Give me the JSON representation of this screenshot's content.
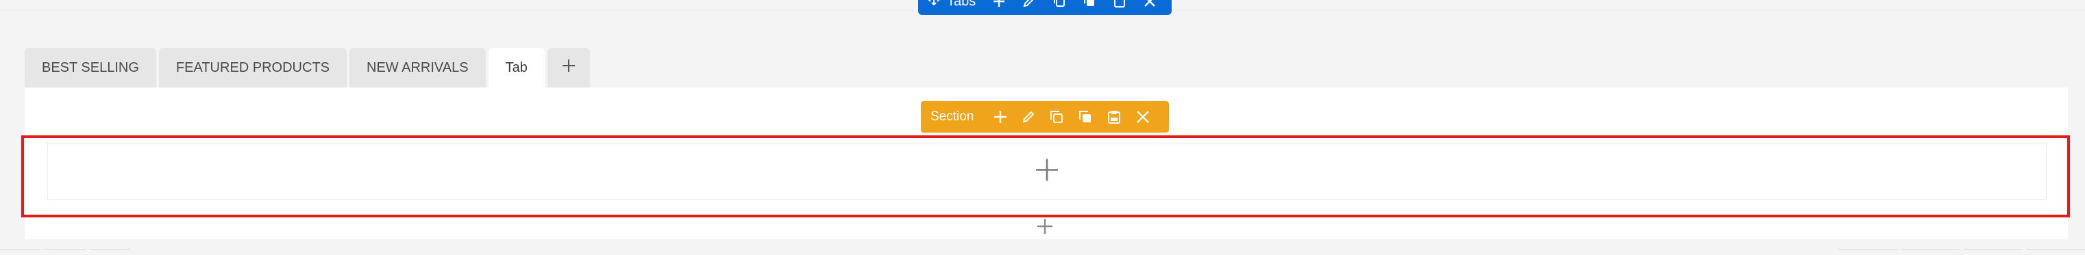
{
  "tabs_toolbar": {
    "label": "Tabs",
    "icons": [
      "drag-icon",
      "add-icon",
      "edit-icon",
      "duplicate-icon",
      "copy-icon",
      "paste-icon",
      "delete-icon"
    ],
    "color": "#0b6bd6"
  },
  "tabs": [
    {
      "label": "BEST SELLING",
      "active": false
    },
    {
      "label": "FEATURED PRODUCTS",
      "active": false
    },
    {
      "label": "NEW ARRIVALS",
      "active": false
    },
    {
      "label": "Tab",
      "active": true
    }
  ],
  "add_tab_icon": "plus-icon",
  "section_toolbar": {
    "label": "Section",
    "icons": [
      "add-icon",
      "edit-icon",
      "duplicate-icon",
      "copy-icon",
      "paste-icon",
      "delete-icon"
    ],
    "color": "#f0a41c"
  },
  "section": {
    "selected": true,
    "border_color": "#e31b1b",
    "add_icon": "plus-icon"
  },
  "below_add_icon": "plus-icon"
}
